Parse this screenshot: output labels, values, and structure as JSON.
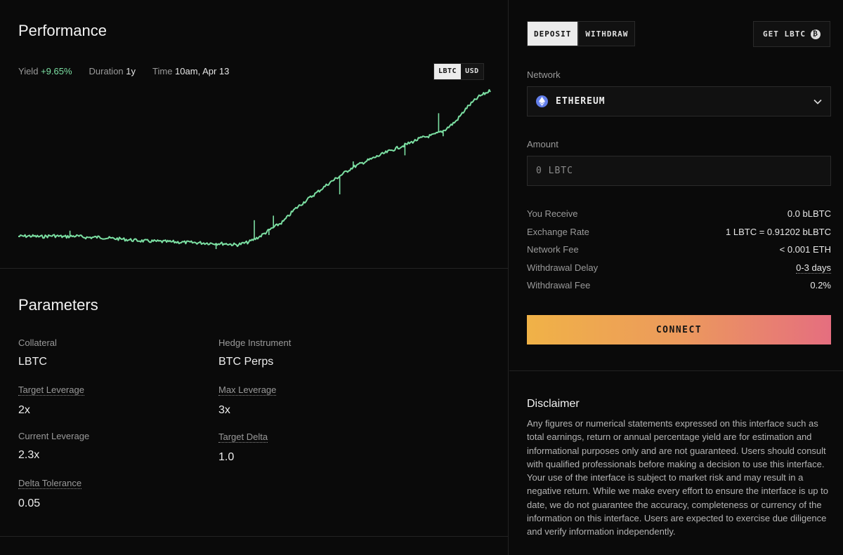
{
  "performance": {
    "title": "Performance",
    "yield_label": "Yield",
    "yield_value": "+9.65%",
    "duration_label": "Duration",
    "duration_value": "1y",
    "time_label": "Time",
    "time_value": "10am, Apr 13",
    "unit_toggle": {
      "options": [
        "LBTC",
        "USD"
      ],
      "selected": "LBTC"
    }
  },
  "chart_data": {
    "type": "line",
    "series": [
      {
        "color": "#7ce0a3",
        "values": [
          0.0,
          0.01,
          -0.01,
          0.02,
          -0.01,
          0.01,
          -0.03,
          -0.02,
          -0.05,
          -0.07,
          -0.1,
          -0.12,
          -0.13,
          -0.14,
          -0.15,
          -0.16,
          -0.17,
          -0.18,
          -0.19,
          -0.22,
          -0.15,
          0.0,
          0.2,
          0.38,
          0.7,
          0.93,
          1.15,
          1.38,
          1.58,
          1.78,
          1.92,
          2.05,
          2.18,
          2.3,
          2.42,
          2.55,
          2.62,
          2.75,
          2.98,
          3.35,
          3.62,
          3.78
        ]
      }
    ]
  },
  "parameters": {
    "title": "Parameters",
    "items": [
      {
        "label": "Collateral",
        "value": "LBTC"
      },
      {
        "label": "Hedge Instrument",
        "value": "BTC Perps"
      },
      {
        "label": "Target Leverage",
        "value": "2x"
      },
      {
        "label": "Max Leverage",
        "value": "3x"
      },
      {
        "label": "Current Leverage",
        "value": "2.3x"
      },
      {
        "label": "Target Delta",
        "value": "1.0"
      },
      {
        "label": "Delta Tolerance",
        "value": "0.05"
      }
    ]
  },
  "form": {
    "tabs": [
      "DEPOSIT",
      "WITHDRAW"
    ],
    "active_tab": "DEPOSIT",
    "get_button": "GET LBTC",
    "network_label": "Network",
    "network_value": "ETHEREUM",
    "amount_label": "Amount",
    "amount_placeholder": "0 LBTC",
    "summary": [
      {
        "label": "You Receive",
        "value": "0.0 bLBTC"
      },
      {
        "label": "Exchange Rate",
        "value": "1 LBTC = 0.91202 bLBTC"
      },
      {
        "label": "Network Fee",
        "value": "< 0.001 ETH"
      },
      {
        "label": "Withdrawal Delay",
        "value": "0-3 days"
      },
      {
        "label": "Withdrawal Fee",
        "value": "0.2%"
      }
    ],
    "connect_button": "CONNECT"
  },
  "disclaimer": {
    "title": "Disclaimer",
    "text": "Any figures or numerical statements expressed on this interface such as total earnings, return or annual percentage yield are for estimation and informational purposes only and are not guaranteed. Users should consult with qualified professionals before making a decision to use this interface. Your use of the interface is subject to market risk and may result in a negative return. While we make every effort to ensure the interface is up to date, we do not guarantee the accuracy, completeness or currency of the information on this interface. Users are expected to exercise due diligence and verify information independently."
  }
}
